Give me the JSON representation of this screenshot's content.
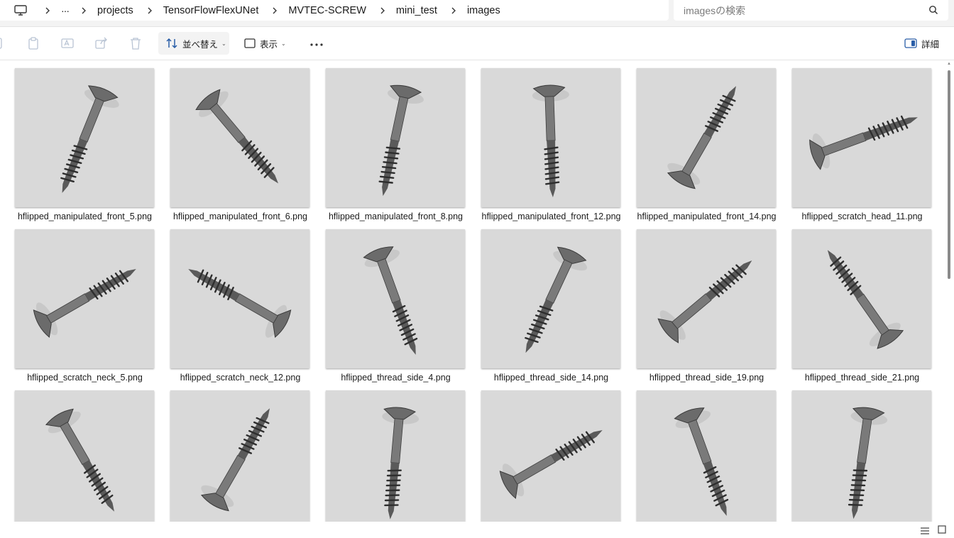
{
  "breadcrumb": {
    "segments": [
      "projects",
      "TensorFlowFlexUNet",
      "MVTEC-SCREW",
      "mini_test",
      "images"
    ]
  },
  "search": {
    "placeholder": "imagesの検索"
  },
  "toolbar": {
    "sort_label": "並べ替え",
    "view_label": "表示",
    "details_label": "詳細"
  },
  "files": [
    {
      "name": "hflipped_manipulated_front_5.png"
    },
    {
      "name": "hflipped_manipulated_front_6.png"
    },
    {
      "name": "hflipped_manipulated_front_8.png"
    },
    {
      "name": "hflipped_manipulated_front_12.png"
    },
    {
      "name": "hflipped_manipulated_front_14.png"
    },
    {
      "name": "hflipped_scratch_head_11.png"
    },
    {
      "name": "hflipped_scratch_neck_5.png"
    },
    {
      "name": "hflipped_scratch_neck_12.png"
    },
    {
      "name": "hflipped_thread_side_4.png"
    },
    {
      "name": "hflipped_thread_side_14.png"
    },
    {
      "name": "hflipped_thread_side_19.png"
    },
    {
      "name": "hflipped_thread_side_21.png"
    },
    {
      "name": ""
    },
    {
      "name": ""
    },
    {
      "name": ""
    },
    {
      "name": ""
    },
    {
      "name": ""
    },
    {
      "name": ""
    }
  ]
}
